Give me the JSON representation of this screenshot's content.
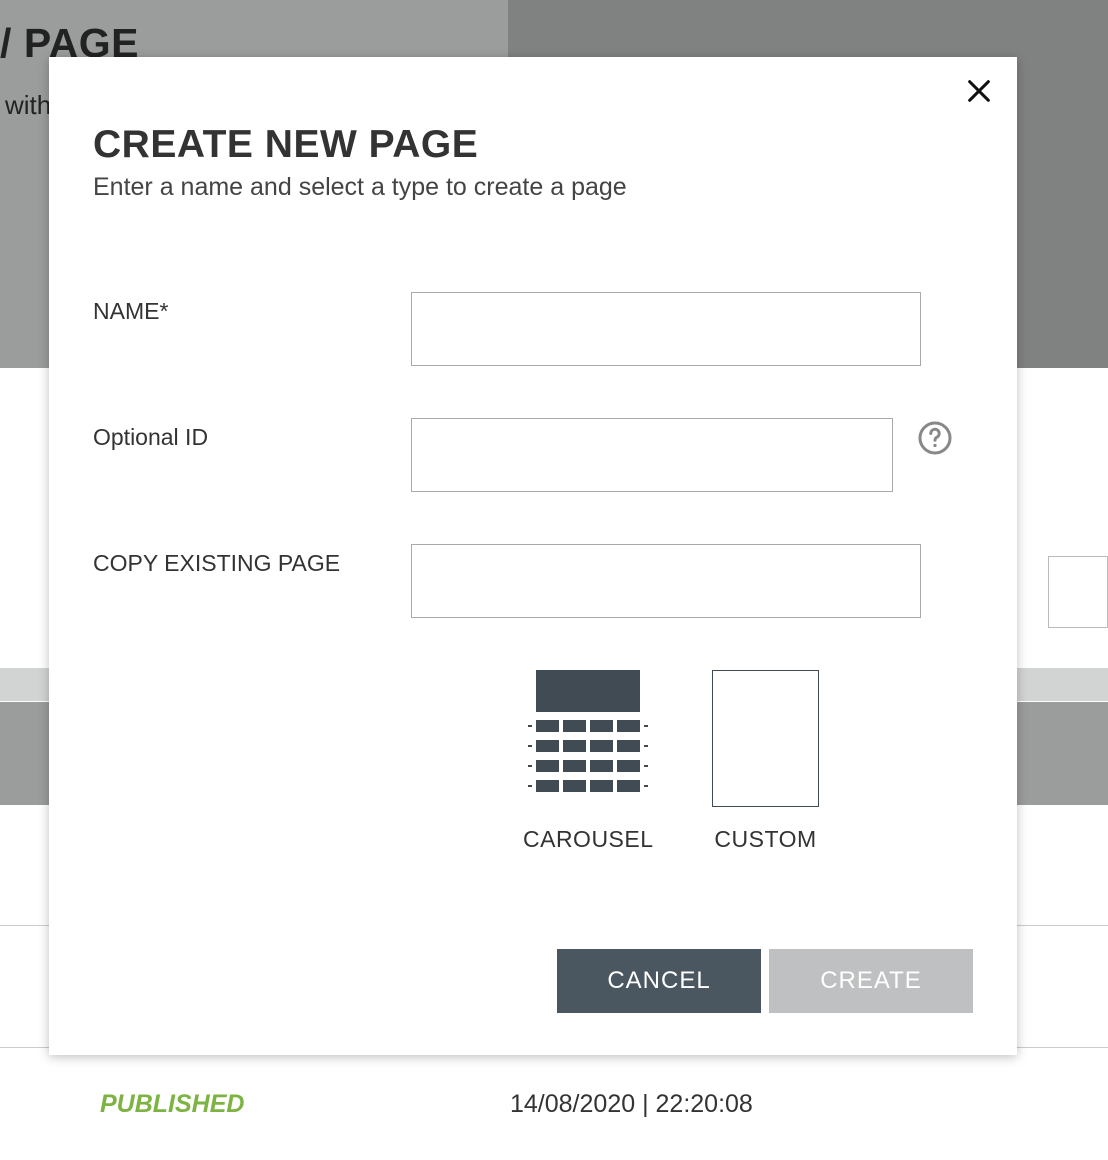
{
  "background": {
    "title_fragment": "PAGE",
    "title_prefix": "/",
    "subtitle_fragment": "with",
    "status": "PUBLISHED",
    "date": "14/08/2020 | 22:20:08"
  },
  "modal": {
    "title": "CREATE NEW PAGE",
    "subtitle": "Enter a name and select a type to create a page",
    "fields": {
      "name_label": "NAME*",
      "name_value": "",
      "optional_id_label": "Optional ID",
      "optional_id_value": "",
      "copy_existing_label": "COPY EXISTING PAGE",
      "copy_existing_value": ""
    },
    "types": {
      "carousel": "CAROUSEL",
      "custom": "CUSTOM"
    },
    "buttons": {
      "cancel": "CANCEL",
      "create": "CREATE"
    }
  }
}
